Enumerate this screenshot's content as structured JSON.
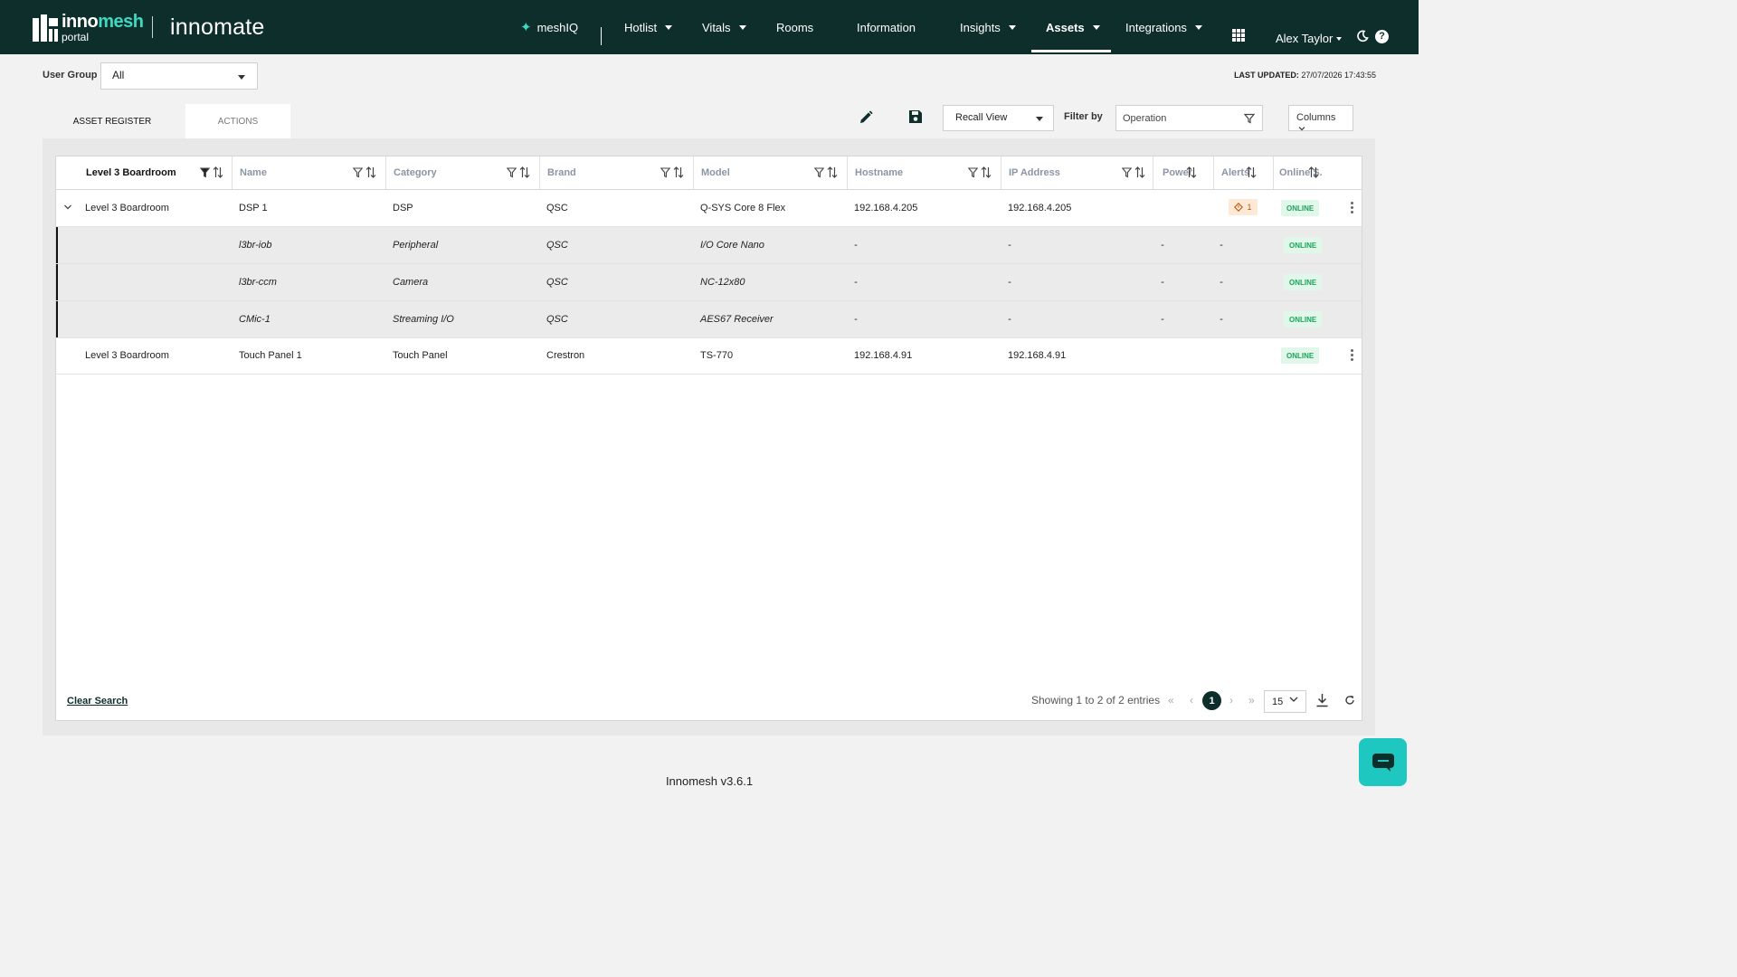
{
  "app": {
    "brand_top": "inno",
    "brand_top_accent": "mesh",
    "brand_sub": "portal",
    "brand_innomate": "innomate",
    "accent_color": "#3dd9c1",
    "topbar_color": "#0e2e2c"
  },
  "nav": {
    "meshiq": "meshIQ",
    "hotlist": "Hotlist",
    "vitals": "Vitals",
    "rooms": "Rooms",
    "information": "Information",
    "insights": "Insights",
    "assets": "Assets",
    "integrations": "Integrations",
    "user": "Alex Taylor",
    "active": "Assets"
  },
  "user_group": {
    "label": "User Group",
    "value": "All"
  },
  "last_updated": {
    "label": "LAST UPDATED:",
    "value": "27/07/2026 17:43:55"
  },
  "tabs": {
    "asset_register": "ASSET REGISTER",
    "actions": "ACTIONS",
    "active": "ASSET REGISTER"
  },
  "toolbar": {
    "recall_view": "Recall View",
    "filter_by_label": "Filter by",
    "filter_by_value": "Operation",
    "columns": "Columns"
  },
  "table": {
    "headers": [
      "Level 3 Boardroom",
      "Name",
      "Category",
      "Brand",
      "Model",
      "Hostname",
      "IP Address",
      "Power",
      "Alerts",
      "Online S."
    ],
    "rows": [
      {
        "room": "Level 3 Boardroom",
        "name": "DSP 1",
        "category": "DSP",
        "brand": "QSC",
        "model": "Q-SYS Core 8 Flex",
        "hostname": "192.168.4.205",
        "ip": "192.168.4.205",
        "power": "",
        "alerts": "1",
        "status": "ONLINE"
      },
      {
        "room": "",
        "name": "l3br-iob",
        "category": "Peripheral",
        "brand": "QSC",
        "model": "I/O Core Nano",
        "hostname": "-",
        "ip": "-",
        "power": "-",
        "alerts": "-",
        "status": "ONLINE"
      },
      {
        "room": "",
        "name": "l3br-ccm",
        "category": "Camera",
        "brand": "QSC",
        "model": "NC-12x80",
        "hostname": "-",
        "ip": "-",
        "power": "-",
        "alerts": "-",
        "status": "ONLINE"
      },
      {
        "room": "",
        "name": "CMic-1",
        "category": "Streaming I/O",
        "brand": "QSC",
        "model": "AES67 Receiver",
        "hostname": "-",
        "ip": "-",
        "power": "-",
        "alerts": "-",
        "status": "ONLINE"
      },
      {
        "room": "Level 3 Boardroom",
        "name": "Touch Panel 1",
        "category": "Touch Panel",
        "brand": "Crestron",
        "model": "TS-770",
        "hostname": "192.168.4.91",
        "ip": "192.168.4.91",
        "power": "",
        "alerts": "",
        "status": "ONLINE"
      }
    ]
  },
  "pagination": {
    "clear_search": "Clear Search",
    "showing": "Showing 1 to 2 of 2 entries",
    "current_page": "1",
    "page_size": "15"
  },
  "footer": {
    "version": "Innomesh v3.6.1"
  }
}
